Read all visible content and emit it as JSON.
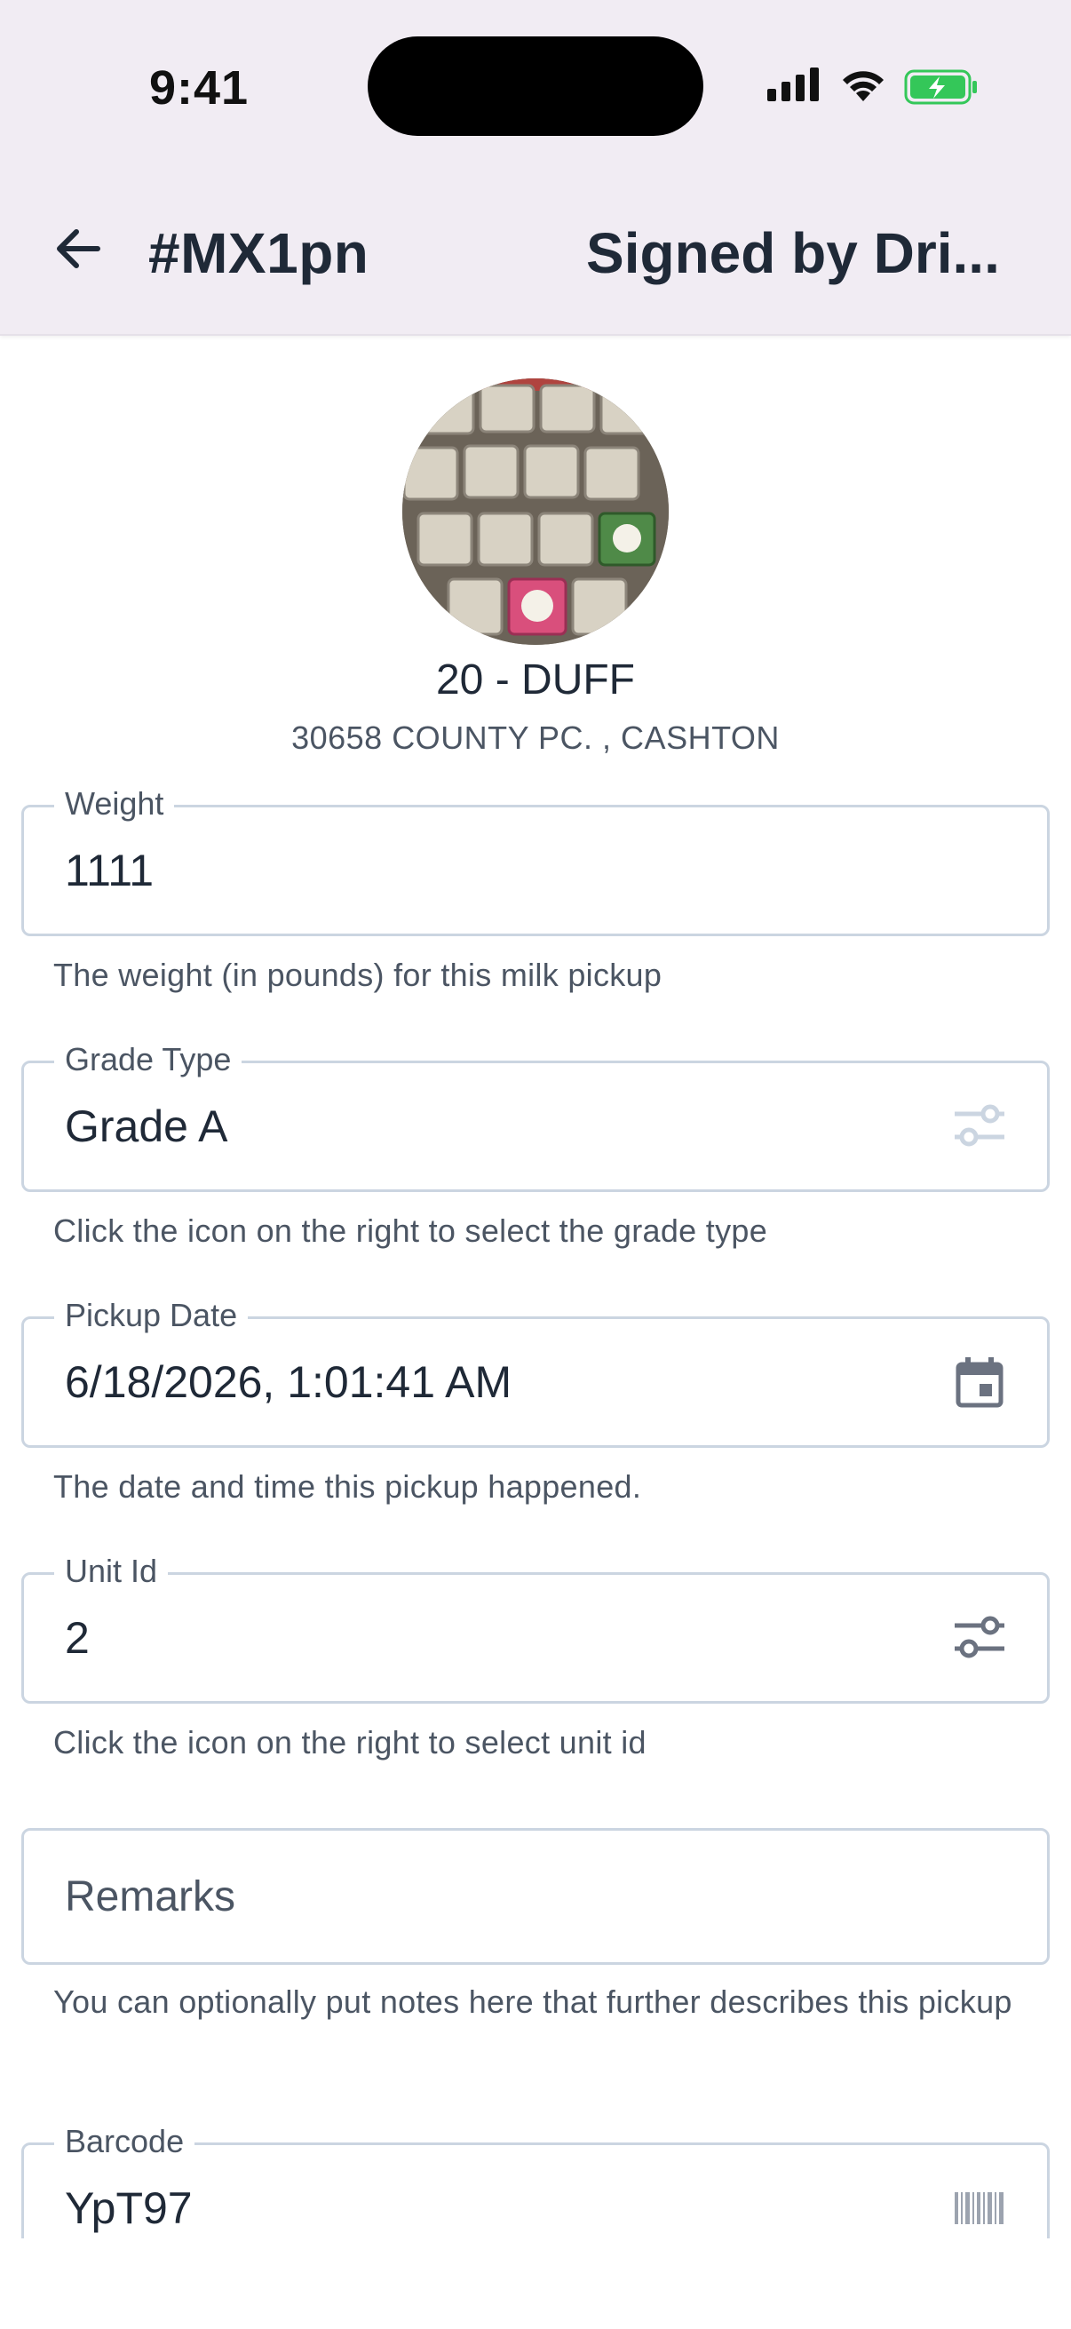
{
  "status_bar": {
    "time": "9:41",
    "signal_icon": "cellular-signal-icon",
    "wifi_icon": "wifi-icon",
    "battery_icon": "battery-charging-icon",
    "battery_color": "#34c759"
  },
  "app_bar": {
    "back_icon": "arrow-left-icon",
    "title": "#MX1pn",
    "status": "Signed by Dri..."
  },
  "profile": {
    "name": "20 - DUFF",
    "address": "30658 COUNTY PC. , CASHTON"
  },
  "form": {
    "weight": {
      "label": "Weight",
      "value": "1111",
      "helper": "The weight (in pounds) for this milk pickup"
    },
    "grade_type": {
      "label": "Grade Type",
      "value": "Grade A",
      "helper": "Click the icon on the right to select the grade type",
      "icon": "tune-icon"
    },
    "pickup_date": {
      "label": "Pickup Date",
      "value": "6/18/2026, 1:01:41 AM",
      "helper": "The date and time this pickup happened.",
      "icon": "calendar-icon"
    },
    "unit_id": {
      "label": "Unit Id",
      "value": "2",
      "helper": "Click the icon on the right to select unit id",
      "icon": "tune-icon"
    },
    "remarks": {
      "placeholder": "Remarks",
      "helper": "You can optionally put notes here that further describes this pickup"
    },
    "barcode": {
      "label": "Barcode",
      "value": "YpT97",
      "icon": "barcode-icon"
    }
  },
  "colors": {
    "header_bg": "#f1ecf3",
    "border": "#cbd5e1",
    "text": "#1f2937",
    "muted": "#4b5563"
  }
}
